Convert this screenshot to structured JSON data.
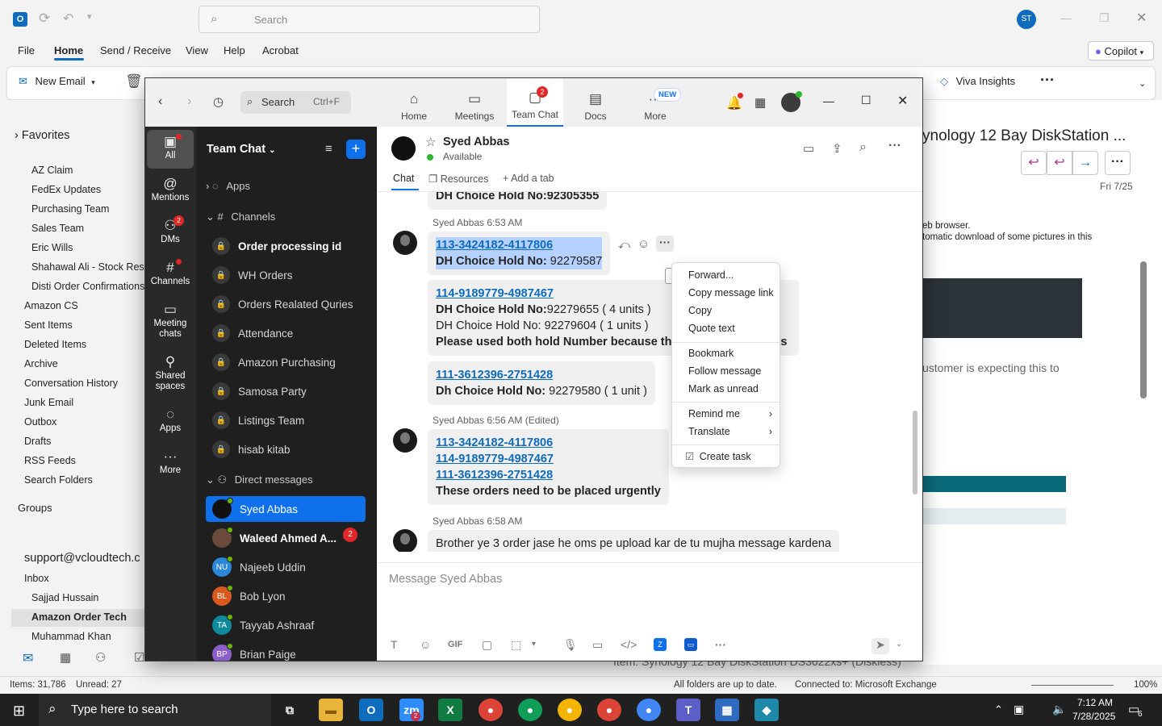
{
  "outlook": {
    "search_placeholder": "Search",
    "avatar_initials": "ST",
    "menu": [
      "File",
      "Home",
      "Send / Receive",
      "View",
      "Help",
      "Acrobat"
    ],
    "copilot_label": "Copilot",
    "new_email_label": "New Email",
    "viva_label": "Viva Insights",
    "favorites_label": "Favorites",
    "folders": [
      "AZ Claim",
      "FedEx Updates",
      "Purchasing Team",
      "Sales Team",
      "Eric Wills",
      "Shahawal Ali - Stock Reser",
      "Disti Order Confirmations",
      "Amazon CS",
      "Sent Items",
      "Deleted Items",
      "Archive",
      "Conversation History",
      "Junk Email",
      "Outbox",
      "Drafts",
      "RSS Feeds",
      "Search Folders"
    ],
    "groups_label": "Groups",
    "account_label": "support@vcloudtech.c",
    "inbox_label": "Inbox",
    "inbox_items": [
      "Sajjad Hussain",
      "Amazon Order Tech",
      "Muhammad Khan"
    ],
    "reading_subject": "ynology 12 Bay DiskStation ...",
    "reading_date": "Fri 7/25",
    "reading_line1": "eb browser.",
    "reading_line2": "tomatic download of some pictures in this",
    "reading_body": "ustomer is expecting this to",
    "reading_item": "Item: Synology 12 Bay DiskStation DS3622xs+ (Diskless)",
    "status_items": "Items: 31,786",
    "status_unread": "Unread: 27",
    "status_sync": "All folders are up to date.",
    "status_conn": "Connected to: Microsoft Exchange",
    "zoom": "100%"
  },
  "taskbar": {
    "search_placeholder": "Type here to search",
    "time": "7:12 AM",
    "date": "7/28/2025",
    "notif_count": "6",
    "teams_badge": "2"
  },
  "teams": {
    "search_label": "Search",
    "search_shortcut": "Ctrl+F",
    "tabs": [
      "Home",
      "Meetings",
      "Team Chat",
      "Docs",
      "More"
    ],
    "team_chat_badge": "2",
    "more_badge": "NEW",
    "rail": [
      "All",
      "Mentions",
      "DMs",
      "Channels",
      "Meeting chats",
      "Shared spaces",
      "Apps",
      "More"
    ],
    "dms_badge": "2",
    "list_title": "Team Chat",
    "apps_label": "Apps",
    "channels_label": "Channels",
    "channels": [
      "Order processing id",
      "WH Orders",
      "Orders Realated Quries",
      "Attendance",
      "Amazon Purchasing",
      "Samosa Party",
      "Listings Team",
      "hisab kitab"
    ],
    "dm_label": "Direct messages",
    "dms": [
      {
        "name": "Syed Abbas",
        "initials": ""
      },
      {
        "name": "Waleed Ahmed A...",
        "initials": "",
        "badge": "2"
      },
      {
        "name": "Najeeb Uddin",
        "initials": "NU"
      },
      {
        "name": "Bob Lyon",
        "initials": "BL"
      },
      {
        "name": "Tayyab Ashraaf",
        "initials": "TA"
      },
      {
        "name": "Brian Paige",
        "initials": "BP"
      }
    ],
    "chat_name": "Syed Abbas",
    "chat_status": "Available",
    "chat_tabs": [
      "Chat",
      "Resources",
      "Add a tab"
    ],
    "top_partial": "DH Choice Hold No:92305355",
    "msg1_meta": "Syed Abbas 6:53 AM",
    "msg1_link": "113-3424182-4117806",
    "msg1_bold": "DH Choice Hold No:",
    "msg1_val": " 92279587",
    "msg2_link": "114-9189779-4987467",
    "msg2_l2b": "DH Choice Hold No:",
    "msg2_l2": "92279655 ( 4 units )",
    "msg2_l3": "DH Choice Hold No: 92279604 ( 1 units )",
    "msg2_l4": "Please used both hold Number because th",
    "msg2_tail": "ts",
    "msg3_link": "111-3612396-2751428",
    "msg3_bold": "Dh Choice Hold No:",
    "msg3_val": " 92279580 ( 1 unit )",
    "msg4_meta": "Syed Abbas 6:56 AM (Edited)",
    "msg4_links": [
      "113-3424182-4117806",
      "114-9189779-4987467",
      "111-3612396-2751428"
    ],
    "msg4_bold": "These orders need to be placed urgently",
    "msg5_meta": "Syed Abbas 6:58 AM",
    "msg5_text": "Brother ye 3 order jase he oms pe upload kar de tu mujha message kardena",
    "compose_placeholder": "Message Syed Abbas",
    "context_menu": [
      "Forward...",
      "Copy message link",
      "Copy",
      "Quote text",
      "Bookmark",
      "Follow message",
      "Mark as unread",
      "Remind me",
      "Translate",
      "Create task"
    ]
  }
}
